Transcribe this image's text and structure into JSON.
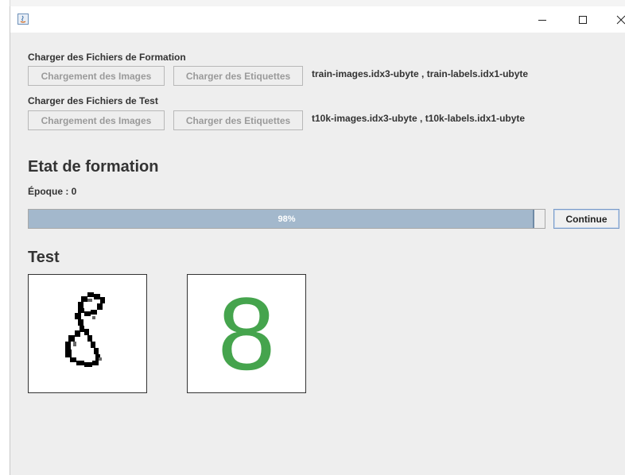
{
  "window": {
    "min_icon": "minimize-icon",
    "max_icon": "maximize-icon",
    "close_icon": "close-icon"
  },
  "training": {
    "label": "Charger des Fichiers de Formation",
    "load_images_label": "Chargement des Images",
    "load_labels_label": "Charger des Etiquettes",
    "files": "train-images.idx3-ubyte , train-labels.idx1-ubyte"
  },
  "testing": {
    "label": "Charger des Fichiers de Test",
    "load_images_label": "Chargement des Images",
    "load_labels_label": "Charger des Etiquettes",
    "files": "t10k-images.idx3-ubyte , t10k-labels.idx1-ubyte"
  },
  "status": {
    "heading": "Etat de formation",
    "epoch": "Époque : 0",
    "progress_percent": 98,
    "progress_text": "98%",
    "continue_label": "Continue"
  },
  "test": {
    "heading": "Test",
    "prediction": "8",
    "prediction_color": "#45a44d"
  }
}
